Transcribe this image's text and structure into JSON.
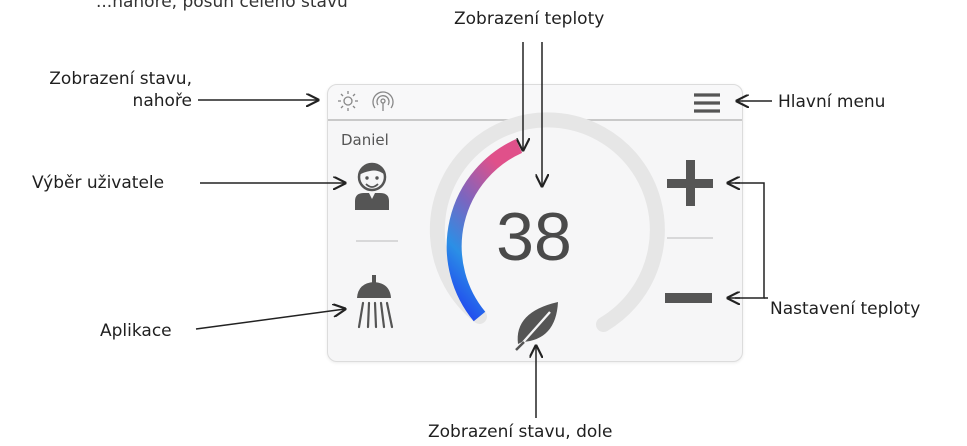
{
  "labels": {
    "cut_top": "...nahoře, posun celého stavu",
    "status_top": "Zobrazení stavu,\nnahoře",
    "temperature_display": "Zobrazení teploty",
    "main_menu": "Hlavní menu",
    "user_selection": "Výběr uživatele",
    "applications": "Aplikace",
    "temperature_setting": "Nastavení teploty",
    "status_bottom": "Zobrazení stavu, dole"
  },
  "panel": {
    "user_name": "Daniel",
    "temperature": "38",
    "temperature_gauge_fraction": 0.38
  },
  "icons": {
    "status_top": [
      "sun-icon",
      "wireless-signal-icon"
    ],
    "menu": "hamburger-menu-icon",
    "user": "user-avatar-icon",
    "application": "shower-head-icon",
    "increase": "plus-icon",
    "decrease": "minus-icon",
    "status_bottom": "leaf-icon"
  },
  "colors": {
    "gauge_start": "#1f39f0",
    "gauge_mid1": "#2b8fe6",
    "gauge_mid2": "#7a66c0",
    "gauge_end": "#e0508a",
    "gauge_track": "#e6e6e6",
    "icon": "#555555",
    "arrow": "#222222"
  }
}
